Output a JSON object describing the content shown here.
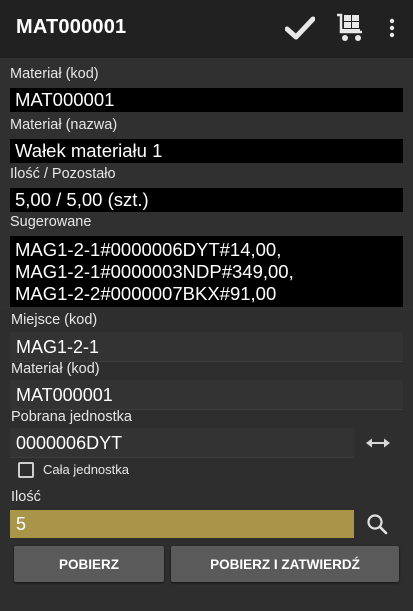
{
  "appbar": {
    "title": "MAT000001",
    "actions": [
      "check-icon",
      "cart-icon",
      "more-vert-icon"
    ]
  },
  "material_code": {
    "label": "Materiał (kod)",
    "value": "MAT000001"
  },
  "material_name": {
    "label": "Materiał (nazwa)",
    "value": "Wałek materiału 1"
  },
  "quantity_remaining": {
    "label": "Ilość / Pozostało",
    "value": "5,00 / 5,00 (szt.)"
  },
  "suggested": {
    "label": "Sugerowane",
    "lines": [
      "MAG1-2-1#0000006DYT#14,00,",
      "MAG1-2-1#0000003NDP#349,00,",
      "MAG1-2-2#0000007BKX#91,00"
    ]
  },
  "location": {
    "label": "Miejsce (kod)",
    "value": "MAG1-2-1"
  },
  "material_code2": {
    "label": "Materiał (kod)",
    "value": "MAT000001"
  },
  "unit": {
    "label": "Pobrana jednostka",
    "value": "0000006DYT"
  },
  "whole_unit": {
    "label": "Cała jednostka",
    "checked": false
  },
  "quantity": {
    "label": "Ilość",
    "value": "5"
  },
  "buttons": {
    "take": "POBIERZ",
    "take_confirm": "POBIERZ I ZATWIERDŹ"
  },
  "colors": {
    "appbar": "#212121",
    "background": "#303030",
    "qty_field": "#a9954a",
    "button": "#5a5a5a"
  }
}
